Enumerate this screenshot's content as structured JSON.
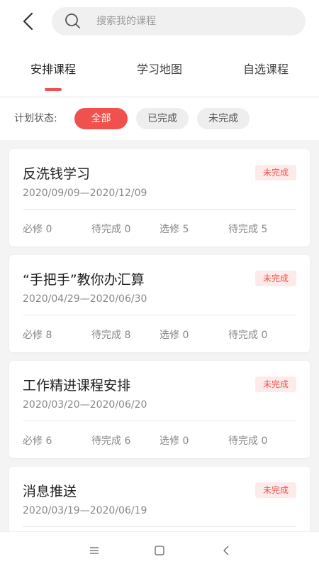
{
  "search": {
    "placeholder": "搜索我的课程"
  },
  "tabs": [
    {
      "label": "安排课程",
      "active": true
    },
    {
      "label": "学习地图"
    },
    {
      "label": "自选课程"
    }
  ],
  "filter": {
    "label": "计划状态:",
    "options": [
      {
        "label": "全部",
        "selected": true
      },
      {
        "label": "已完成"
      },
      {
        "label": "未完成"
      }
    ]
  },
  "courses": [
    {
      "title": "反洗钱学习",
      "date": "2020/09/09—2020/12/09",
      "status": "未完成",
      "required": "必修 0",
      "pending": "待完成 0",
      "elective": "选修 5",
      "elective_pending": "待完成 5"
    },
    {
      "title": "“手把手”教你办汇算",
      "date": "2020/04/29—2020/06/30",
      "status": "未完成",
      "required": "必修 8",
      "pending": "待完成 8",
      "elective": "选修 0",
      "elective_pending": "待完成 0"
    },
    {
      "title": "工作精进课程安排",
      "date": "2020/03/20—2020/06/20",
      "status": "未完成",
      "required": "必修 6",
      "pending": "待完成 6",
      "elective": "选修 0",
      "elective_pending": "待完成 0"
    },
    {
      "title": "消息推送",
      "date": "2020/03/19—2020/06/19",
      "status": "未完成"
    }
  ],
  "colors": {
    "accent": "#f0514c",
    "badge_bg": "#fdebea"
  },
  "icons": {
    "back": "chevron-left-icon",
    "search": "search-icon",
    "nav": [
      "menu-icon",
      "home-square-icon",
      "back-triangle-icon"
    ]
  }
}
